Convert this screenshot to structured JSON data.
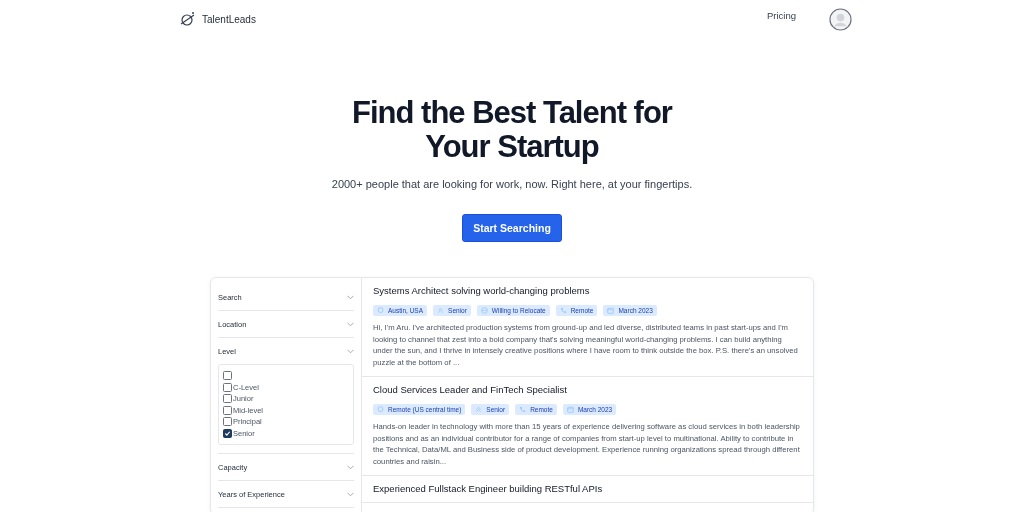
{
  "header": {
    "brand": "TalentLeads",
    "nav": [
      "Pricing"
    ]
  },
  "hero": {
    "title": "Find the Best Talent for Your Startup",
    "subtitle": "2000+ people that are looking for work, now. Right here, at your fingertips.",
    "button": "Start Searching"
  },
  "filters": [
    {
      "label": "Search"
    },
    {
      "label": "Location"
    },
    {
      "label": "Level",
      "options": [
        {
          "checked": false
        },
        {
          "label": "C-Level",
          "checked": false
        },
        {
          "label": "Junior",
          "checked": false
        },
        {
          "label": "Mid-level",
          "checked": false
        },
        {
          "label": "Principal",
          "checked": false
        },
        {
          "label": "Senior",
          "checked": true
        }
      ]
    },
    {
      "label": "Capacity"
    },
    {
      "label": "Years of Experience"
    }
  ],
  "results": [
    {
      "title": "Systems Architect solving world-changing problems",
      "tags": [
        {
          "kind": "location",
          "text": "Austin, USA"
        },
        {
          "kind": "level",
          "text": "Senior"
        },
        {
          "kind": "relocate",
          "text": "Willing to Relocate"
        },
        {
          "kind": "capacity",
          "text": "Remote"
        },
        {
          "kind": "date",
          "text": "March 2023"
        }
      ],
      "summary": "Hi, I'm Aru. I've architected production systems from ground-up and led diverse, distributed teams in past start-ups and I'm looking to channel that zest into a bold company that's solving meaningful world-changing problems. I can build anything under the sun, and I thrive in intensely creative positions where I have room to think outside the box. P.S. there's an unsolved puzzle at the bottom of ..."
    },
    {
      "title": "Cloud Services Leader and FinTech Specialist",
      "tags": [
        {
          "kind": "location",
          "text": "Remote (US central time)"
        },
        {
          "kind": "level",
          "text": "Senior"
        },
        {
          "kind": "capacity",
          "text": "Remote"
        },
        {
          "kind": "date",
          "text": "March 2023"
        }
      ],
      "summary": "Hands-on leader in technology with more than 15 years of experience delivering software as cloud services in both leadership positions and as an individual contributor for a range of companies from start-up level to multinational. Ability to contribute in the Technical, Data/ML and Business side of product development. Experience running organizations spread through different countries and raisin..."
    },
    {
      "title": "Experienced Fullstack Engineer building RESTful APIs"
    }
  ]
}
